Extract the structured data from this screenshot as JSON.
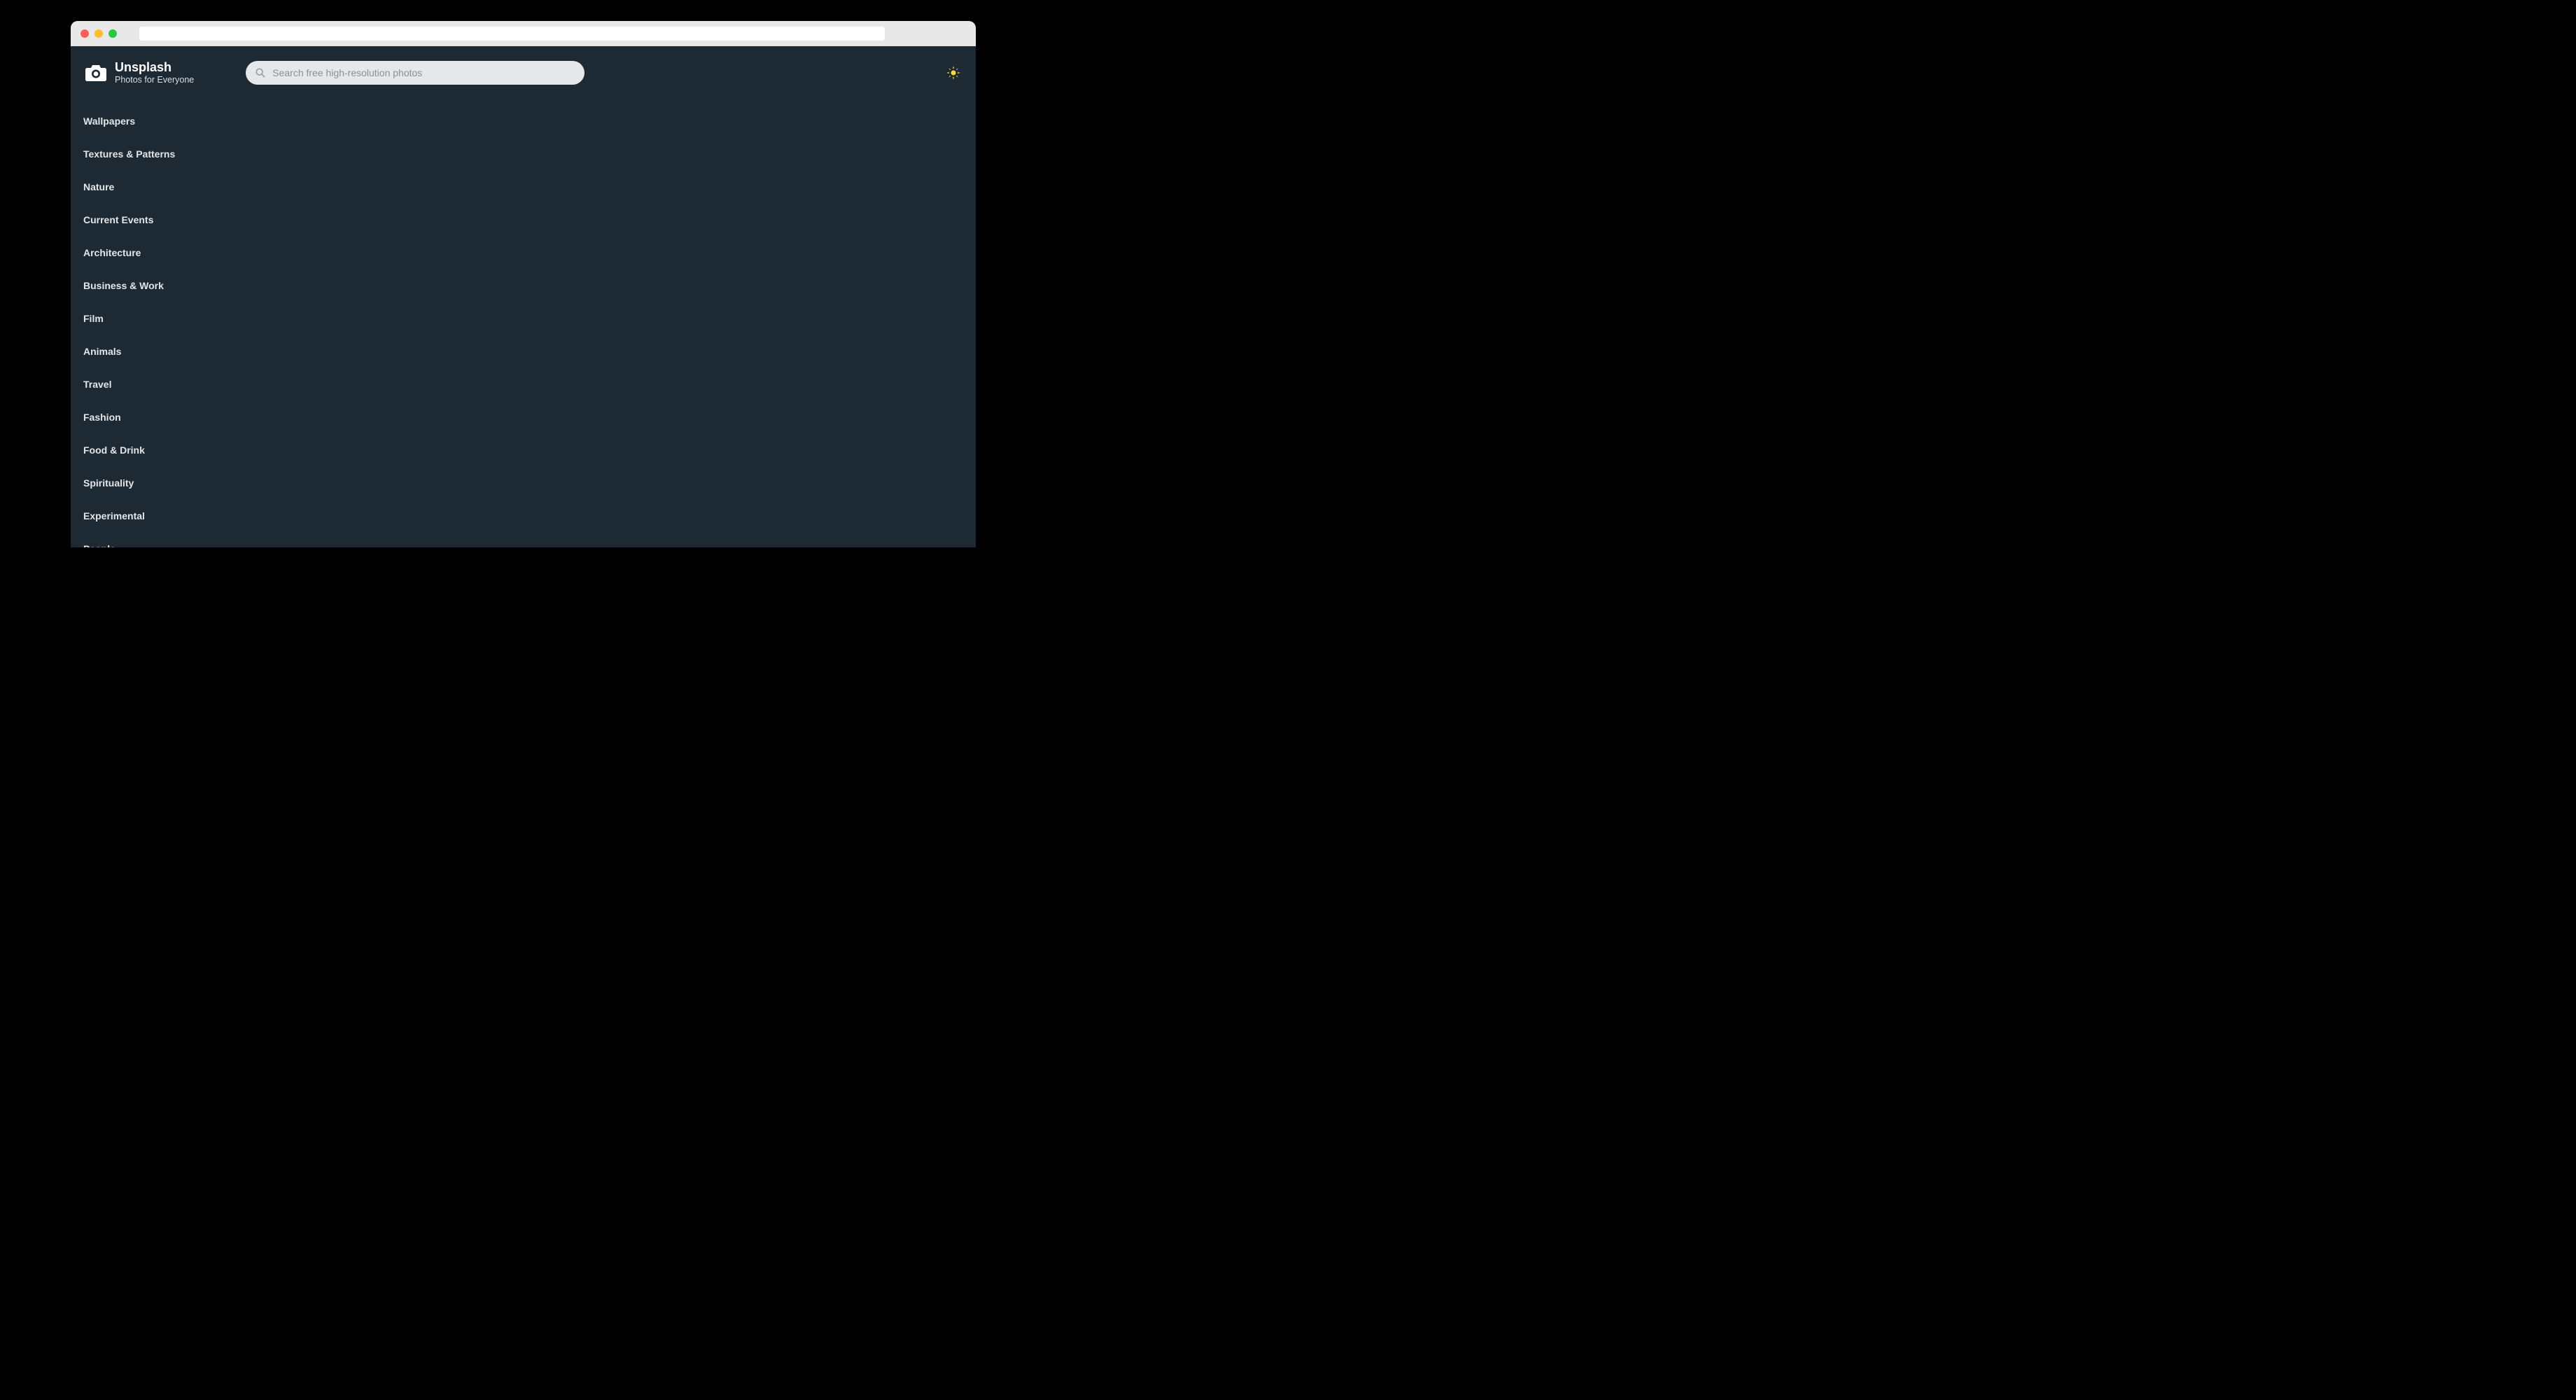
{
  "brand": {
    "title": "Unsplash",
    "subtitle": "Photos for Everyone"
  },
  "search": {
    "placeholder": "Search free high-resolution photos",
    "value": ""
  },
  "categories": [
    "Wallpapers",
    "Textures & Patterns",
    "Nature",
    "Current Events",
    "Architecture",
    "Business & Work",
    "Film",
    "Animals",
    "Travel",
    "Fashion",
    "Food & Drink",
    "Spirituality",
    "Experimental",
    "People"
  ],
  "icons": {
    "logo": "camera-icon",
    "search": "search-icon",
    "theme": "sun-icon"
  }
}
